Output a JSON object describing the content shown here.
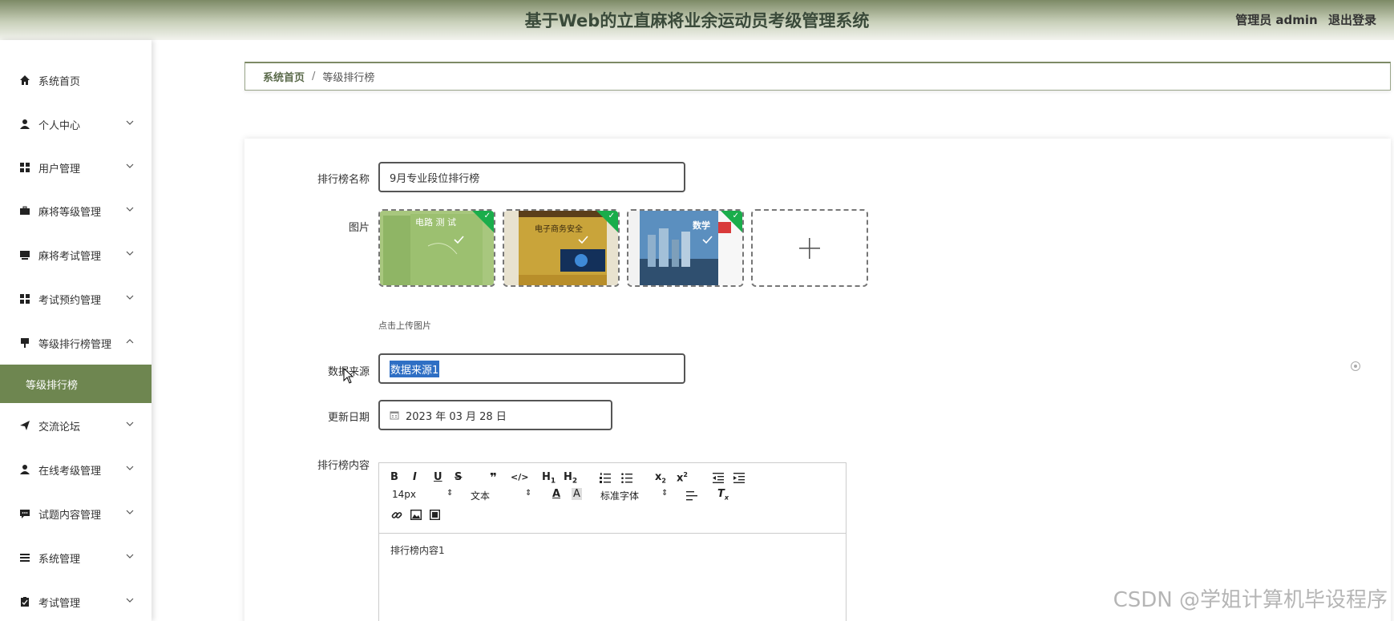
{
  "header": {
    "title": "基于Web的立直麻将业余运动员考级管理系统",
    "user_label": "管理员 admin",
    "logout_label": "退出登录"
  },
  "sidebar": {
    "items": [
      {
        "label": "系统首页",
        "icon": "home-icon"
      },
      {
        "label": "个人中心",
        "icon": "user-icon"
      },
      {
        "label": "用户管理",
        "icon": "grid-icon"
      },
      {
        "label": "麻将等级管理",
        "icon": "briefcase-icon"
      },
      {
        "label": "麻将考试管理",
        "icon": "tray-icon"
      },
      {
        "label": "考试预约管理",
        "icon": "grid-icon"
      },
      {
        "label": "等级排行榜管理",
        "icon": "pin-icon"
      },
      {
        "label": "交流论坛",
        "icon": "send-icon"
      },
      {
        "label": "在线考级管理",
        "icon": "user-icon"
      },
      {
        "label": "试题内容管理",
        "icon": "chat-icon"
      },
      {
        "label": "系统管理",
        "icon": "list-icon"
      },
      {
        "label": "考试管理",
        "icon": "clipboard-icon"
      }
    ],
    "active_submenu": "等级排行榜"
  },
  "breadcrumb": {
    "home": "系统首页",
    "separator": "/",
    "current": "等级排行榜"
  },
  "form": {
    "name_label": "排行榜名称",
    "name_value": "9月专业段位排行榜",
    "image_label": "图片",
    "upload_hint": "点击上传图片",
    "source_label": "数据来源",
    "source_value": "数据来源1",
    "date_label": "更新日期",
    "date_value": "2023 年 03 月 28 日",
    "content_label": "排行榜内容",
    "content_value": "排行榜内容1"
  },
  "editor": {
    "font_size": "14px",
    "block_type": "文本",
    "font_family": "标准字体"
  },
  "watermark": "CSDN @学姐计算机毕设程序",
  "colors": {
    "accent": "#6e8650",
    "header_dark": "#7d8a66",
    "badge_green": "#1aad4b",
    "selection": "#2f6fc4"
  }
}
